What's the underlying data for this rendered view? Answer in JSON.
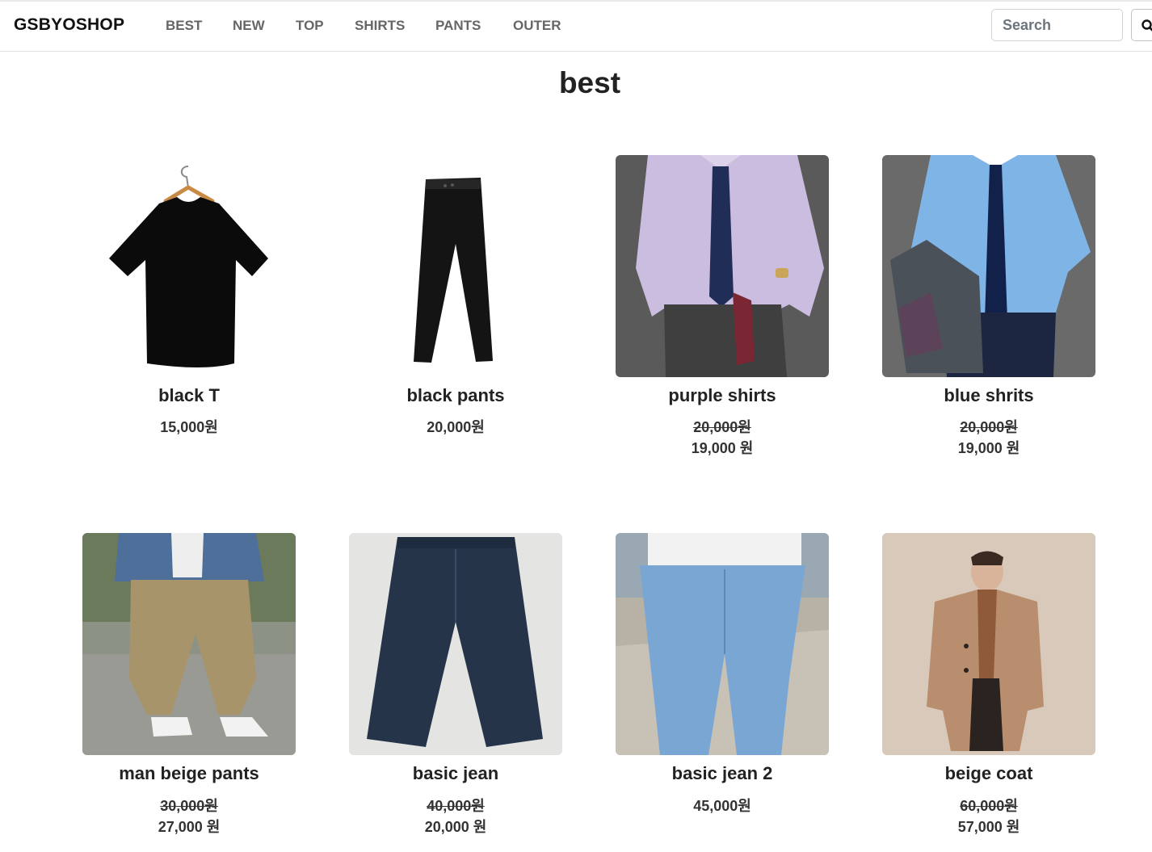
{
  "nav": {
    "brand": "GSBYOSHOP",
    "links": [
      "BEST",
      "NEW",
      "TOP",
      "SHIRTS",
      "PANTS",
      "OUTER"
    ],
    "search_placeholder": "Search"
  },
  "page": {
    "title": "best"
  },
  "products": [
    {
      "name": "black T",
      "price": "15,000원"
    },
    {
      "name": "black pants",
      "price": "20,000원"
    },
    {
      "name": "purple shirts",
      "old_price": "20,000원",
      "new_price": "19,000 원"
    },
    {
      "name": "blue shrits",
      "old_price": "20,000원",
      "new_price": "19,000 원"
    },
    {
      "name": "man beige pants",
      "old_price": "30,000원",
      "new_price": "27,000 원"
    },
    {
      "name": "basic jean",
      "old_price": "40,000원",
      "new_price": "20,000 원"
    },
    {
      "name": "basic jean 2",
      "price": "45,000원"
    },
    {
      "name": "beige coat",
      "old_price": "60,000원",
      "new_price": "57,000 원"
    }
  ],
  "icons": {
    "search": "search-icon"
  }
}
